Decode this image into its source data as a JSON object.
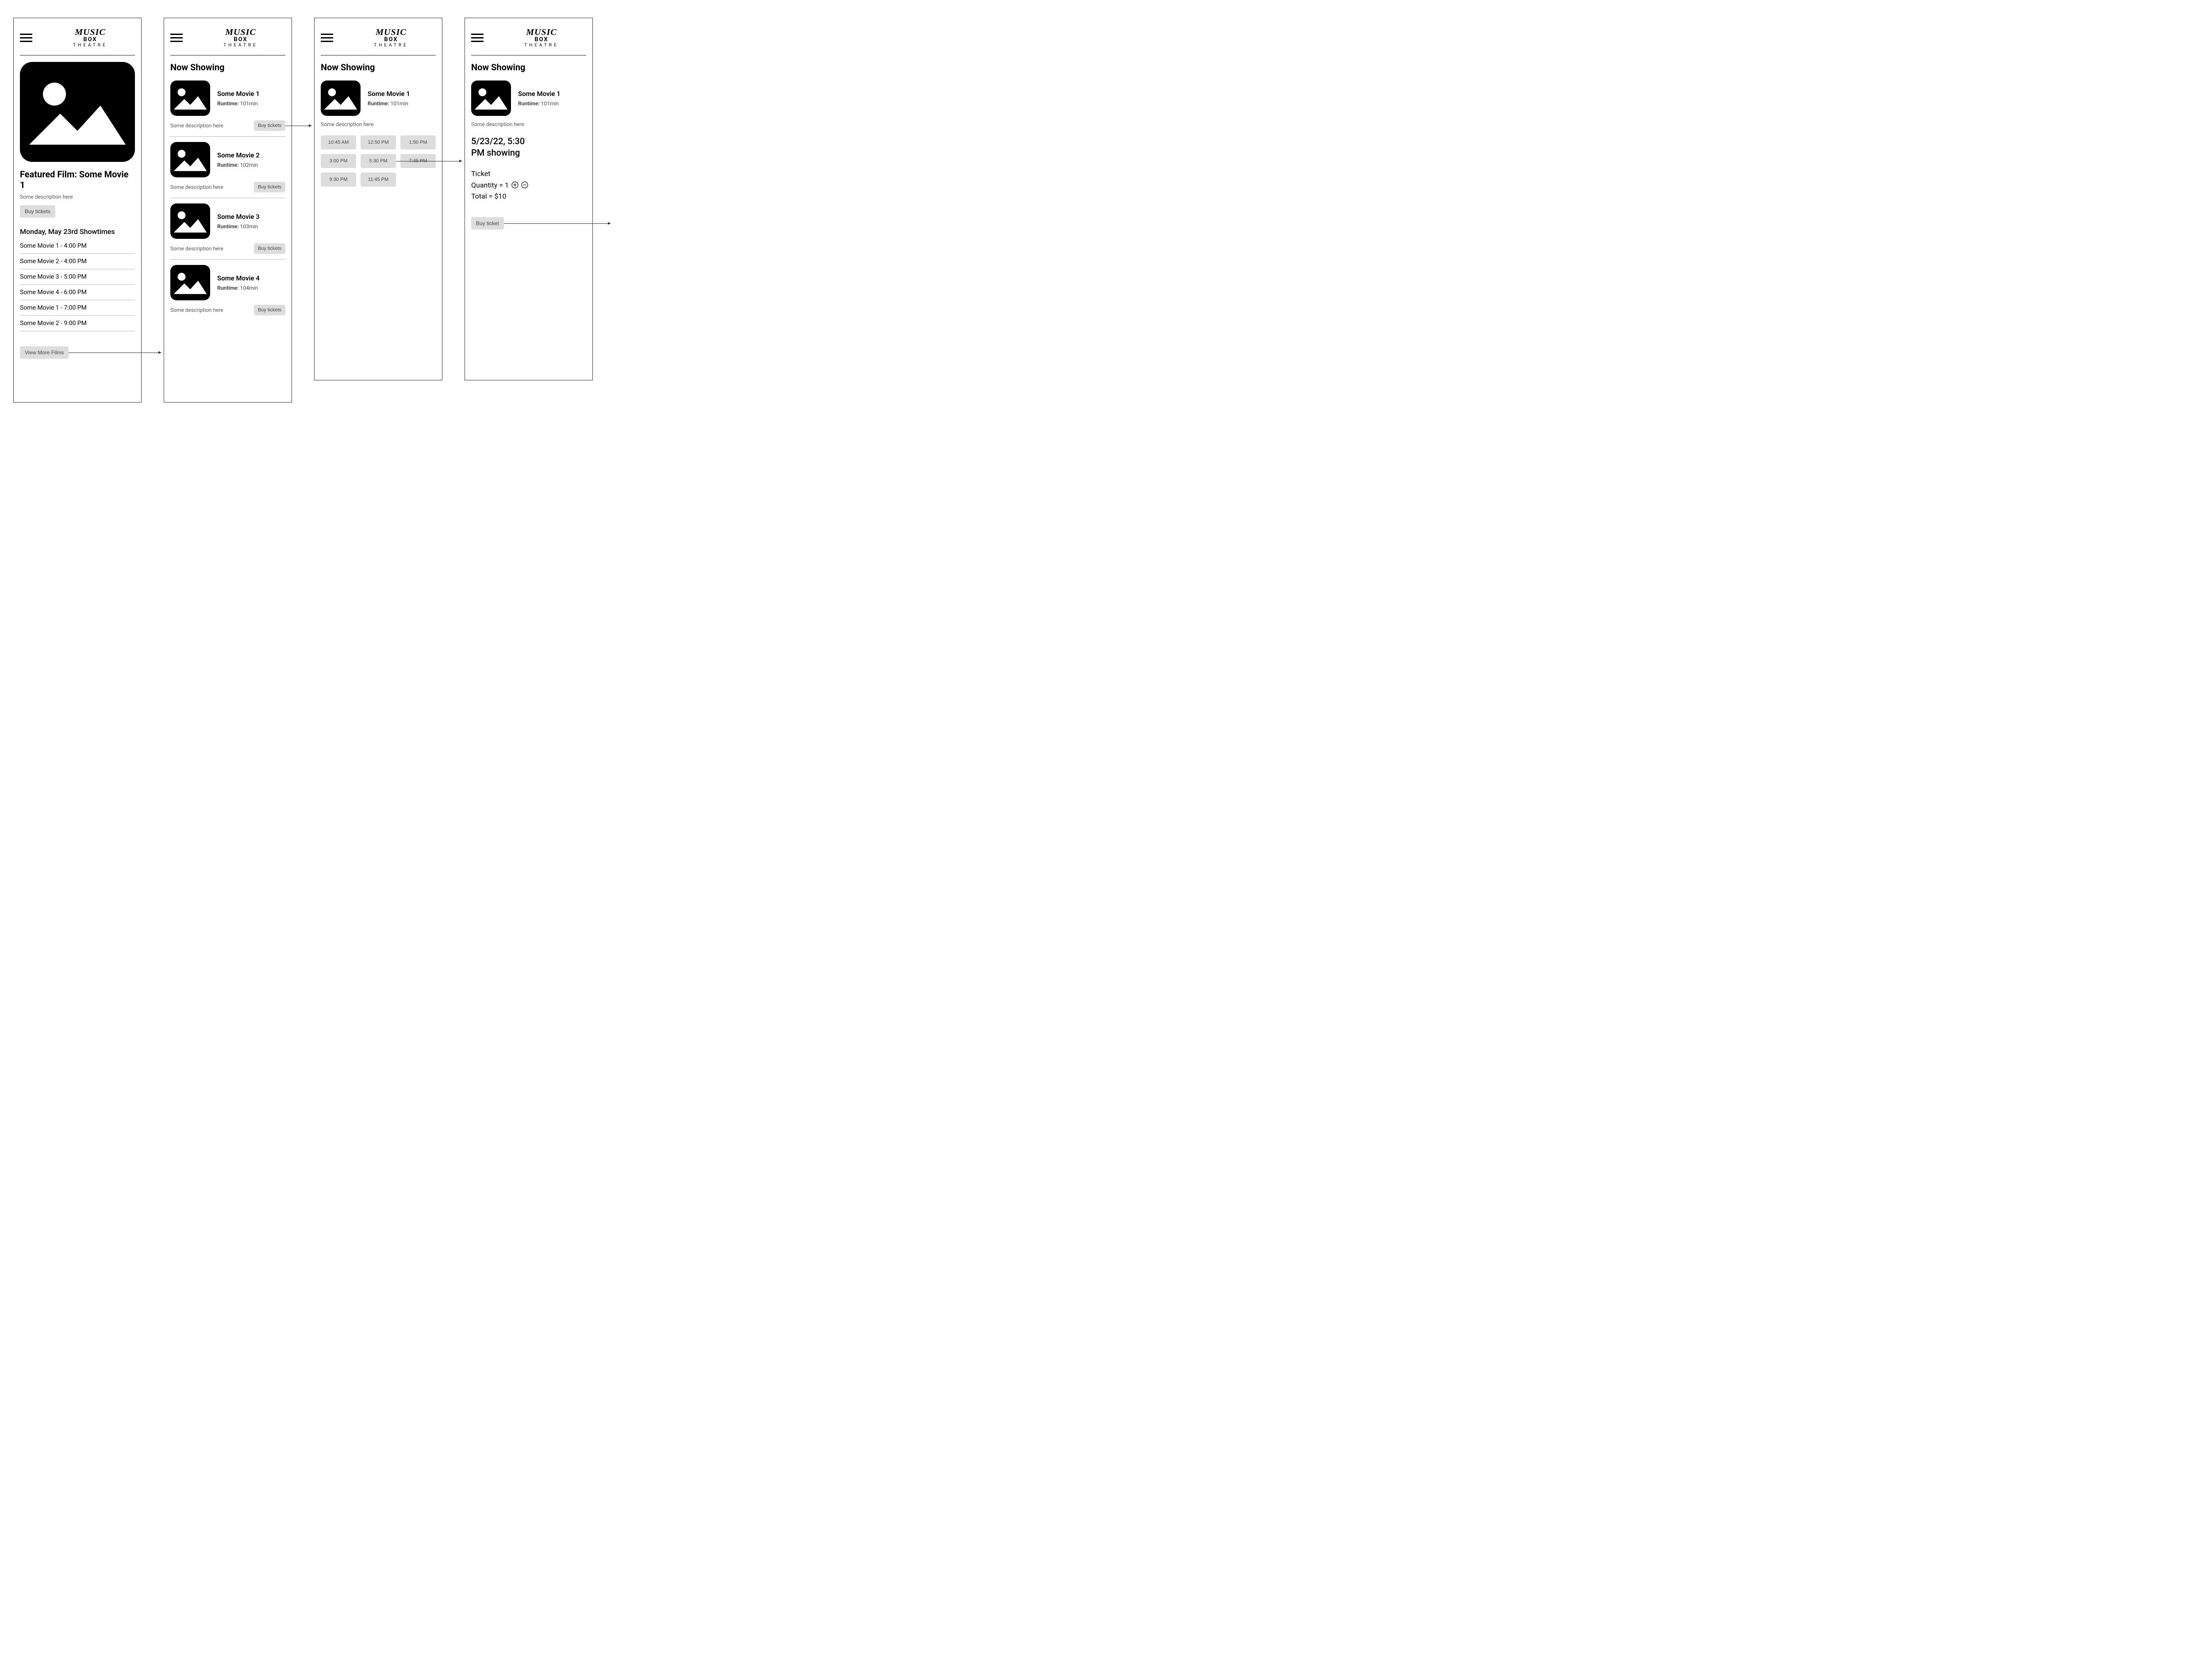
{
  "logo": {
    "line1": "MUSIC",
    "line2": "BOX",
    "line3": "THEATRE"
  },
  "screen1": {
    "featured_prefix": "Featured Film: ",
    "featured_title": "Some Movie 1",
    "description": "Some description here",
    "buy_label": "Buy tickets",
    "showtimes_heading": "Monday, May 23rd Showtimes",
    "showtimes": [
      "Some Movie 1 - 4:00 PM",
      "Some Movie 2 - 4:00 PM",
      "Some Movie 3 - 5:00 PM",
      "Some Movie 4 - 6:00 PM",
      "Some Movie 1 - 7:00 PM",
      "Some Movie 2 - 9:00 PM"
    ],
    "view_more_label": "View More Films"
  },
  "screen2": {
    "title": "Now Showing",
    "runtime_label": "Runtime:",
    "buy_label": "Buy tickets",
    "movies": [
      {
        "title": "Some Movie 1",
        "runtime": "101min",
        "desc": "Some description here"
      },
      {
        "title": "Some Movie 2",
        "runtime": "102min",
        "desc": "Some description here"
      },
      {
        "title": "Some Movie 3",
        "runtime": "103min",
        "desc": "Some description here"
      },
      {
        "title": "Some Movie 4",
        "runtime": "104min",
        "desc": "Some description here"
      }
    ]
  },
  "screen3": {
    "title": "Now Showing",
    "movie": {
      "title": "Some Movie 1",
      "runtime": "101min",
      "desc": "Some description here"
    },
    "runtime_label": "Runtime:",
    "times": [
      "10:45 AM",
      "12:50 PM",
      "1:50 PM",
      "3:00 PM",
      "5:30 PM",
      "7:45 PM",
      "9:30 PM",
      "11:45 PM"
    ]
  },
  "screen4": {
    "title": "Now Showing",
    "movie": {
      "title": "Some Movie 1",
      "runtime": "101min",
      "desc": "Some description here"
    },
    "runtime_label": "Runtime:",
    "showing_line1": "5/23/22, 5:30",
    "showing_line2": "PM showing",
    "ticket_label": "Ticket",
    "quantity_label": "Quantity = ",
    "quantity_value": "1",
    "total_label": "Total = ",
    "total_value": "$10",
    "buy_label": "Buy ticket"
  }
}
